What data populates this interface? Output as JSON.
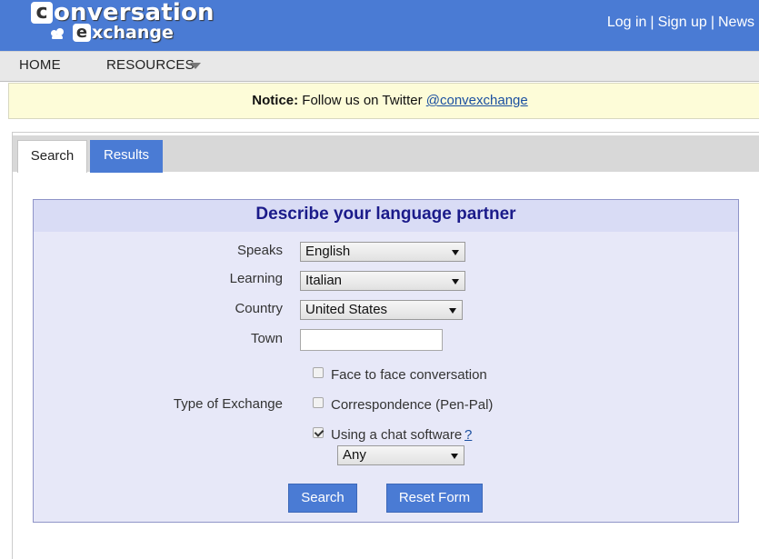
{
  "header": {
    "logo_line1": "onversation",
    "logo_line2": "xchange",
    "logo_c": "c",
    "logo_e": "e",
    "links": [
      "Log in",
      "Sign up",
      "News"
    ],
    "separator": "|"
  },
  "nav": {
    "home": "HOME",
    "resources": "RESOURCES"
  },
  "notice": {
    "label": "Notice:",
    "text": " Follow us on Twitter ",
    "link": "@convexchange"
  },
  "tabs": {
    "search": "Search",
    "results": "Results"
  },
  "form": {
    "title": "Describe your language partner",
    "speaks_label": "Speaks",
    "speaks_value": "English",
    "learning_label": "Learning",
    "learning_value": "Italian",
    "country_label": "Country",
    "country_value": "United States",
    "town_label": "Town",
    "town_value": "",
    "exchange_label": "Type of Exchange",
    "opt_face": "Face to face conversation",
    "opt_corr": "Correspondence (Pen-Pal)",
    "opt_chat": "Using a chat software",
    "help": "?",
    "chat_value": "Any",
    "search_button": "Search",
    "reset_button": "Reset Form"
  },
  "colors": {
    "header_bg": "#4a7bd4",
    "notice_bg": "#fdfcd8",
    "form_bg": "#e7e8f8",
    "form_title": "#1b1b8a"
  }
}
